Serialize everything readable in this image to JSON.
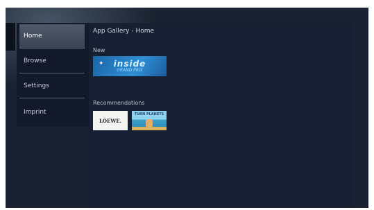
{
  "sidebar": {
    "items": [
      {
        "label": "Home",
        "active": true
      },
      {
        "label": "Browse",
        "active": false
      },
      {
        "label": "Settings",
        "active": false
      },
      {
        "label": "Imprint",
        "active": false
      }
    ]
  },
  "main": {
    "title": "App Gallery - Home",
    "sections": {
      "new": {
        "label": "New",
        "apps": [
          {
            "text": "inside",
            "subtext": "GRAND PRIX"
          }
        ]
      },
      "recommendations": {
        "label": "Recommendations",
        "apps": [
          {
            "text": "LOEWE."
          },
          {
            "text": "TURN PLANETS"
          }
        ]
      }
    }
  },
  "colors": {
    "screen_bg": "#1a2130",
    "sidebar_bg": "#11192a",
    "active_item": "#4f5a68",
    "content_bg": "#172033",
    "inside_tile": "#2f8ed4"
  }
}
